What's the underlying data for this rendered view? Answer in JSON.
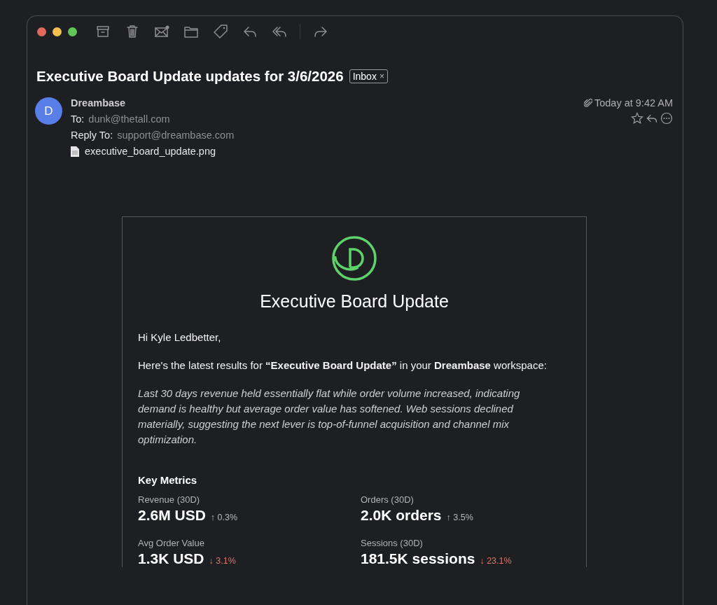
{
  "message": {
    "subject": "Executive Board Update updates for 3/6/2026",
    "mailbox_tag": "Inbox",
    "tag_close": "×",
    "avatar_letter": "D",
    "sender": "Dreambase",
    "to_label": "To:",
    "to": "dunk@thetall.com",
    "reply_to_label": "Reply To:",
    "reply_to": "support@dreambase.com",
    "attachment": "executive_board_update.png",
    "time": "Today at 9:42 AM"
  },
  "email": {
    "title": "Executive Board Update",
    "greeting": "Hi Kyle Ledbetter,",
    "intro": "Here's the latest results for **“Executive Board Update”** in your **Dreambase** workspace:",
    "summary": "Last 30 days revenue held essentially flat while order volume increased, indicating demand is healthy but average order value has softened. Web sessions declined materially, suggesting the next lever is top-of-funnel acquisition and channel mix optimization.",
    "section_title": "Key Metrics",
    "metrics": [
      {
        "label": "Revenue (30D)",
        "value": "2.6M USD",
        "delta": "↑ 0.3%",
        "kind": "up"
      },
      {
        "label": "Orders (30D)",
        "value": "2.0K orders",
        "delta": "↑ 3.5%",
        "kind": "up"
      },
      {
        "label": "Avg Order Value",
        "value": "1.3K USD",
        "delta": "↓ 3.1%",
        "kind": "down"
      },
      {
        "label": "Sessions (30D)",
        "value": "181.5K sessions",
        "delta": "↓ 23.1%",
        "kind": "down"
      }
    ]
  }
}
